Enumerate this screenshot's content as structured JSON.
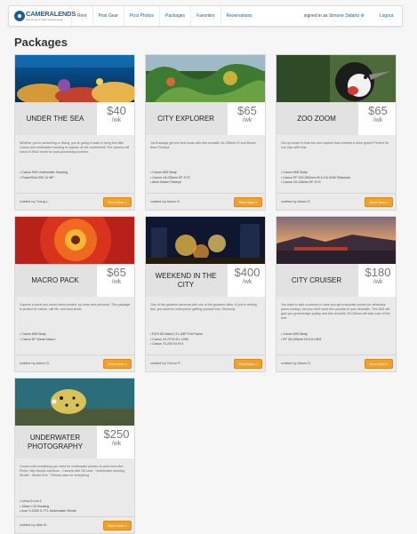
{
  "brand": {
    "name": "CAMERALENDS",
    "tagline": "borrow a pro level camera gear"
  },
  "nav": [
    {
      "label": "Rent"
    },
    {
      "label": "Post Gear"
    },
    {
      "label": "Post Photos"
    },
    {
      "label": "Packages"
    },
    {
      "label": "Favorites"
    },
    {
      "label": "Reservations"
    }
  ],
  "account": {
    "prefix": "signed in as",
    "user": "Simone Sidarto",
    "logout": "Logout"
  },
  "page": {
    "title": "Packages"
  },
  "colors": {
    "accent": "#f0a02c",
    "link": "#1d5f8f"
  },
  "packages": [
    {
      "name": "UNDER THE SEA",
      "price": "$40",
      "unit": "/wk",
      "image": "coral-reef-photo",
      "description": "Whether you're snorkeling or diving, you're going to want to bring this little Canon and underwater housing to capture all the excitement! The camera will shoot in RAW mode for post-processing touches.",
      "gear": [
        "Canon S90 Underwater Housing",
        "PowerShot S90 10 MP"
      ],
      "author": "Trang L.",
      "button": "Rent Now »"
    },
    {
      "name": "CITY EXPLORER",
      "price": "$65",
      "unit": "/wk",
      "image": "garden-greenhouse-photo",
      "description": "You'll always get the best shots with this versatile 16-135mm IS and Bower 8mm Fisheye.",
      "gear": [
        "Canon 60D Body",
        "Canon 18-135mm EF-S IS",
        "8mm Bower Fisheye"
      ],
      "author": "Adam D.",
      "button": "Rent Now »"
    },
    {
      "name": "ZOO ZOOM",
      "price": "$65",
      "unit": "/wk",
      "image": "crowned-crane-photo",
      "description": "Get up closer to that lion and capture that cheetah in slow speed! Perfect for zoo trips with kids.",
      "gear": [
        "Canon 60D Body",
        "Canon EF 100-300mm f/4.5-5.6 USM Telephoto",
        "Canon 18-135mm EF-S IS"
      ],
      "author": "Adam D.",
      "button": "Rent Now »"
    },
    {
      "name": "MACRO PACK",
      "price": "$65",
      "unit": "/wk",
      "image": "red-flower-macro-photo",
      "description": "Capture a world you never knew existed, up close and personal. This package is perfect for nature, still life, and food shots.",
      "gear": [
        "Canon 60D Body",
        "Canon EF 60mm Macro"
      ],
      "author": "Adam D.",
      "button": "Rent Now »"
    },
    {
      "name": "WEEKEND IN THE CITY",
      "price": "$400",
      "unit": "/wk",
      "image": "night-city-lights-photo",
      "description": "One of the greatest cameras with one of the greatest cities. If you're visiting this, you deserve what you're getting yourself into. Seriously.",
      "gear": [
        "EOS 5D Mark II 21.1MP Full Frame",
        "Canon 24-70 f/2.8 L USM",
        "Canon 70-200 f/4 IS II"
      ],
      "author": "Trevor P.",
      "button": "Rent Now »"
    },
    {
      "name": "CITY CRUISER",
      "price": "$180",
      "unit": "/wk",
      "image": "harbor-sunset-photo",
      "description": "You want to take a camera in case you get a surprise sunset (or otherwise photo-worthy), but you don't want few pounds on your shoulder. This 60D will give you great image quality and this versatile 28-105mm will take care of the rest.",
      "gear": [
        "Canon 60D Body",
        "EF 28-105mm f/4.5-6 USM"
      ],
      "author": "Adam D.",
      "button": "Rent Now »"
    },
    {
      "name": "UNDERWATER PHOTOGRAPHY",
      "price": "$250",
      "unit": "/wk",
      "image": "boxfish-underwater-photo",
      "description": "Comes with everything you need for underwater photos on your next dive. Photo: http://snipic.com/fuzz - Camera with SD card · Underwater housing · Strobe · Strobe Arm · Pelican case for everything",
      "gear": [
        "Leica D-Lux 4",
        "10bar LX3 Housing",
        "Inon S-2000 S-TTL Underwater Strobe"
      ],
      "author": "Max B.",
      "button": "Rent Now »"
    }
  ]
}
